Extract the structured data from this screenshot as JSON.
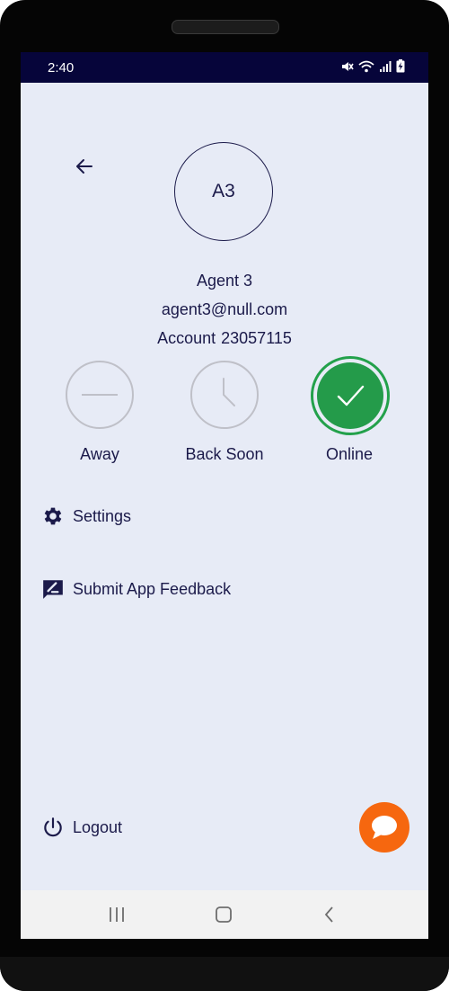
{
  "status_bar": {
    "time": "2:40",
    "icons": [
      "mute-icon",
      "wifi-icon",
      "signal-icon",
      "battery-charging-icon"
    ]
  },
  "profile": {
    "avatar_initials": "A3",
    "name": "Agent 3",
    "email": "agent3@null.com",
    "account_label": "Account",
    "account_number": "23057115"
  },
  "availability": {
    "options": [
      {
        "label": "Away",
        "icon": "minus-icon",
        "selected": false
      },
      {
        "label": "Back Soon",
        "icon": "clock-icon",
        "selected": false
      },
      {
        "label": "Online",
        "icon": "check-icon",
        "selected": true
      }
    ]
  },
  "menu": {
    "settings_label": "Settings",
    "feedback_label": "Submit App Feedback",
    "logout_label": "Logout"
  },
  "colors": {
    "status_bar": "#06053a",
    "background": "#e7ebf6",
    "text": "#1b1a4a",
    "online_green": "#249b4a",
    "chat_orange": "#f6670f"
  }
}
